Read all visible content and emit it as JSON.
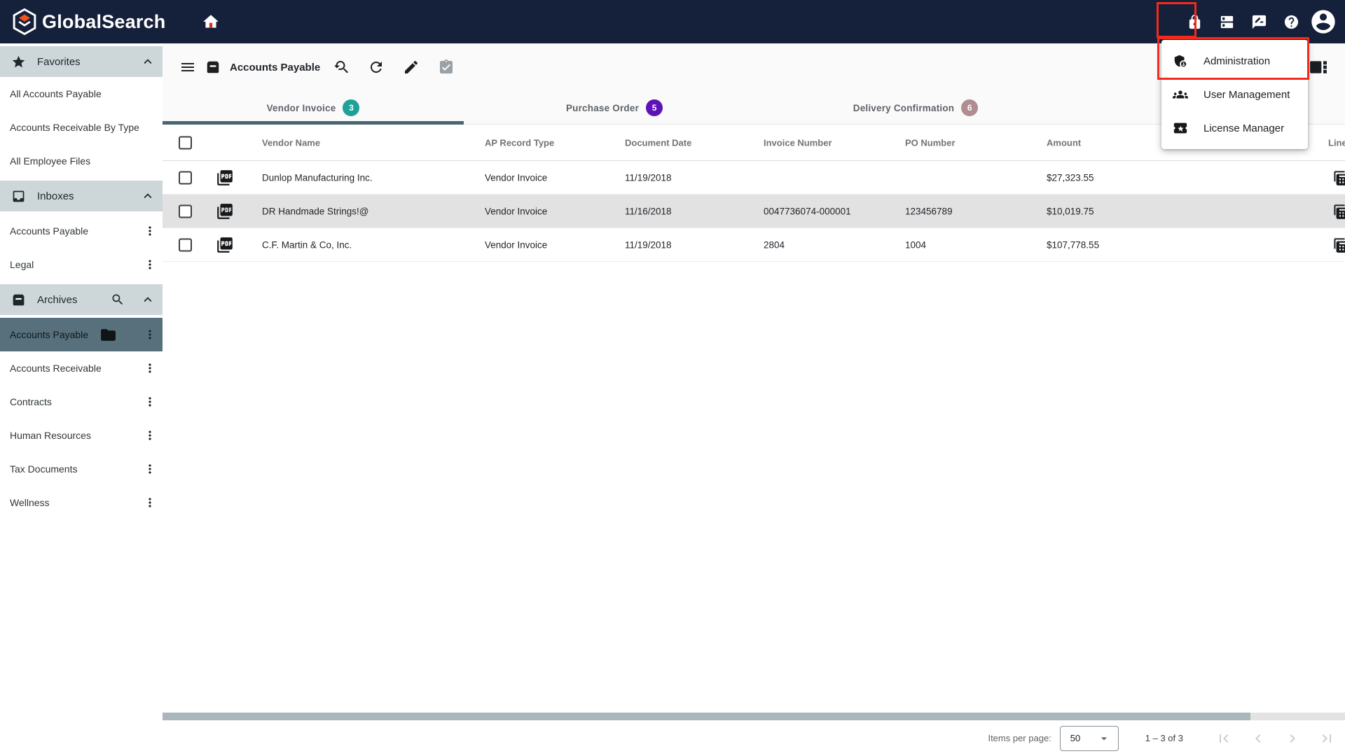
{
  "app": {
    "name": "GlobalSearch"
  },
  "admin_menu": {
    "items": [
      {
        "label": "Administration"
      },
      {
        "label": "User Management"
      },
      {
        "label": "License Manager"
      }
    ]
  },
  "sidebar": {
    "favorites": {
      "title": "Favorites",
      "items": [
        "All Accounts Payable",
        "Accounts Receivable By Type",
        "All Employee Files"
      ]
    },
    "inboxes": {
      "title": "Inboxes",
      "items": [
        "Accounts Payable",
        "Legal"
      ]
    },
    "archives": {
      "title": "Archives",
      "items": [
        "Accounts Payable",
        "Accounts Receivable",
        "Contracts",
        "Human Resources",
        "Tax Documents",
        "Wellness"
      ]
    }
  },
  "toolbar": {
    "title": "Accounts Payable"
  },
  "tabs": [
    {
      "label": "Vendor Invoice",
      "count": "3",
      "badge_color": "#1fa197",
      "active": true
    },
    {
      "label": "Purchase Order",
      "count": "5",
      "badge_color": "#5d13b5",
      "active": false
    },
    {
      "label": "Delivery Confirmation",
      "count": "6",
      "badge_color": "#b08d92",
      "active": false
    }
  ],
  "table": {
    "columns": {
      "vendor": "Vendor Name",
      "type": "AP Record Type",
      "date": "Document Date",
      "invoice": "Invoice Number",
      "po": "PO Number",
      "amount": "Amount",
      "line_items": "Line Items"
    },
    "rows": [
      {
        "vendor": "Dunlop Manufacturing Inc.",
        "type": "Vendor Invoice",
        "date": "11/19/2018",
        "invoice": "",
        "po": "",
        "amount": "$27,323.55"
      },
      {
        "vendor": "DR Handmade Strings!@",
        "type": "Vendor Invoice",
        "date": "11/16/2018",
        "invoice": "0047736074-000001",
        "po": "123456789",
        "amount": "$10,019.75"
      },
      {
        "vendor": "C.F. Martin & Co, Inc.",
        "type": "Vendor Invoice",
        "date": "11/19/2018",
        "invoice": "2804",
        "po": "1004",
        "amount": "$107,778.55"
      }
    ]
  },
  "pagination": {
    "items_per_page_label": "Items per page:",
    "page_size": "50",
    "range": "1 – 3 of 3"
  },
  "colors": {
    "nav_background": "#15203a",
    "annotation_red": "#f5291b",
    "tab_indicator": "#4a6572",
    "selected_sidebar_item": "#57707b",
    "selected_row": "#e2e2e2"
  }
}
